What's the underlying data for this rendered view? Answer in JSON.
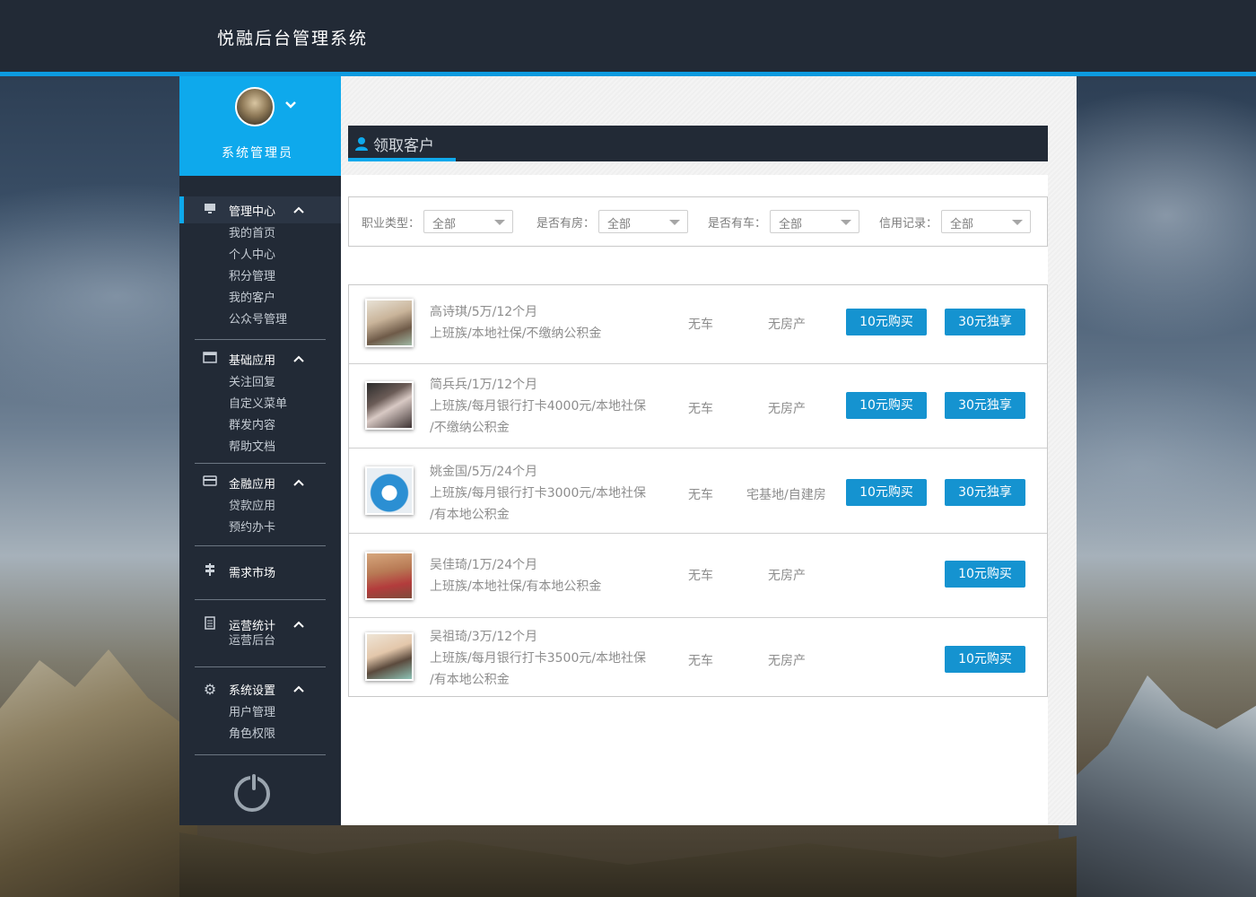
{
  "app": {
    "title": "悦融后台管理系统"
  },
  "user": {
    "name": "系统管理员"
  },
  "sidebar": {
    "groups": [
      {
        "label": "管理中心",
        "icon": "monitor-icon",
        "items": [
          "我的首页",
          "个人中心",
          "积分管理",
          "我的客户",
          "公众号管理"
        ]
      },
      {
        "label": "基础应用",
        "icon": "window-icon",
        "items": [
          "关注回复",
          "自定义菜单",
          "群发内容",
          "帮助文档"
        ]
      },
      {
        "label": "金融应用",
        "icon": "card-icon",
        "items": [
          "贷款应用",
          "预约办卡"
        ]
      },
      {
        "label": "需求市场",
        "icon": "signpost-icon",
        "items": []
      },
      {
        "label": "运营统计",
        "icon": "document-icon",
        "items": [
          "运营后台"
        ]
      },
      {
        "label": "系统设置",
        "icon": "gear-icon",
        "items": [
          "用户管理",
          "角色权限"
        ]
      }
    ]
  },
  "page": {
    "title": "领取客户"
  },
  "filters": [
    {
      "label": "职业类型：",
      "value": "全部"
    },
    {
      "label": "是否有房：",
      "value": "全部"
    },
    {
      "label": "是否有车：",
      "value": "全部"
    },
    {
      "label": "信用记录：",
      "value": "全部"
    }
  ],
  "customers": [
    {
      "lines": [
        "高诗琪/5万/12个月",
        "上班族/本地社保/不缴纳公积金"
      ],
      "car": "无车",
      "house": "无房产",
      "buttons": [
        "10元购买",
        "30元独享"
      ]
    },
    {
      "lines": [
        "简兵兵/1万/12个月",
        "上班族/每月银行打卡4000元/本地社保",
        "/不缴纳公积金"
      ],
      "car": "无车",
      "house": "无房产",
      "buttons": [
        "10元购买",
        "30元独享"
      ]
    },
    {
      "lines": [
        "姚金国/5万/24个月",
        "上班族/每月银行打卡3000元/本地社保",
        "/有本地公积金"
      ],
      "car": "无车",
      "house": "宅基地/自建房",
      "buttons": [
        "10元购买",
        "30元独享"
      ]
    },
    {
      "lines": [
        "吴佳琦/1万/24个月",
        "上班族/本地社保/有本地公积金"
      ],
      "car": "无车",
      "house": "无房产",
      "buttons": [
        "10元购买"
      ]
    },
    {
      "lines": [
        "吴祖琦/3万/12个月",
        "上班族/每月银行打卡3500元/本地社保",
        "/有本地公积金"
      ],
      "car": "无车",
      "house": "无房产",
      "buttons": [
        "10元购买"
      ]
    }
  ],
  "colors": {
    "accent": "#0ea9ec",
    "button": "#1593d0",
    "sidebar": "#222a36"
  }
}
